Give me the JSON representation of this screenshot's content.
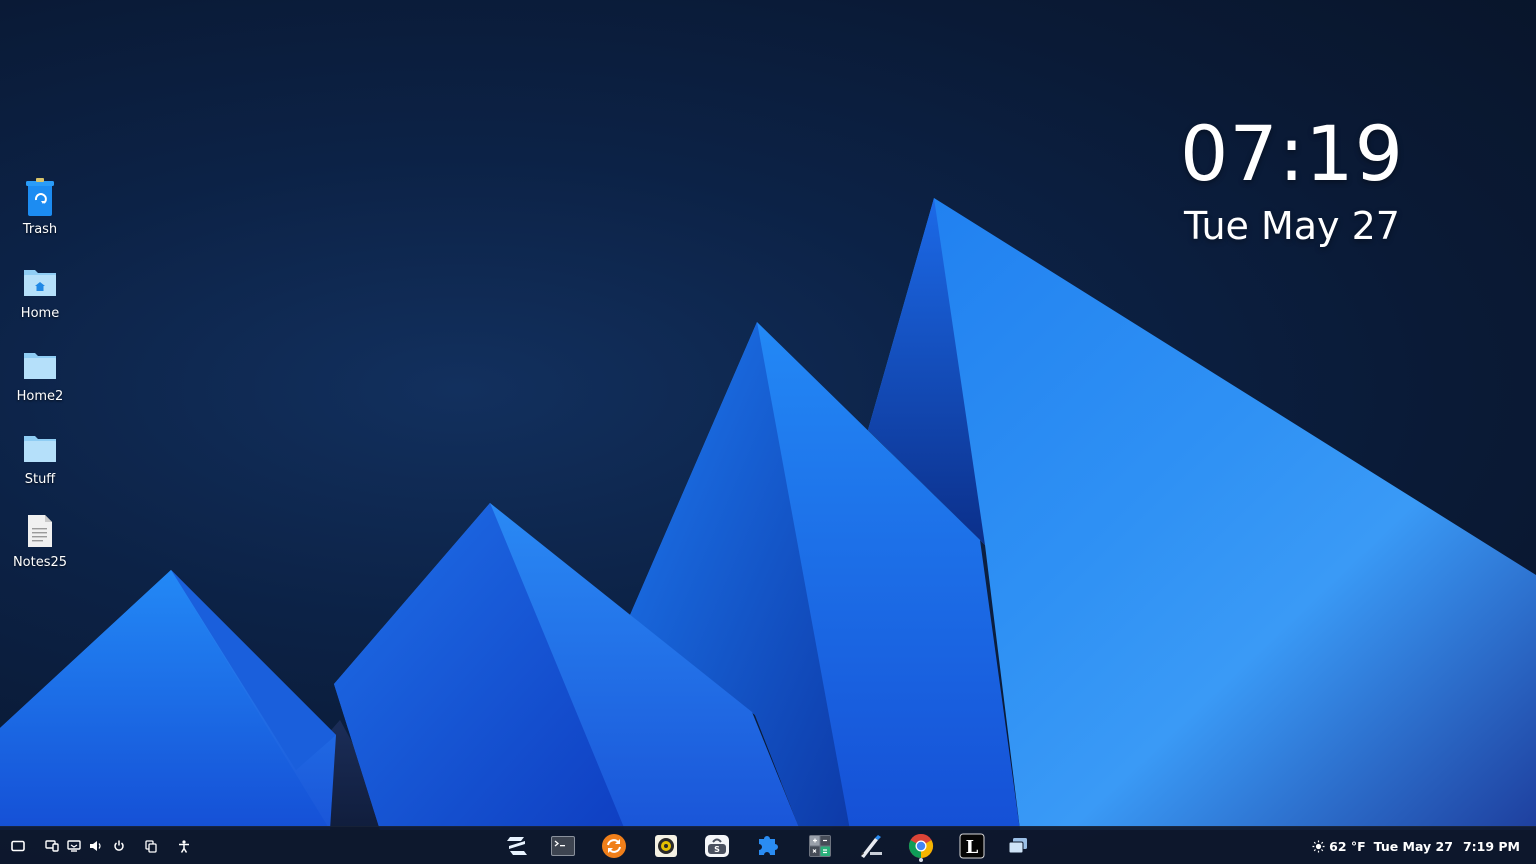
{
  "desktop_icons": [
    {
      "label": "Trash",
      "icon": "trash-icon"
    },
    {
      "label": "Home",
      "icon": "home-folder-icon"
    },
    {
      "label": "Home2",
      "icon": "folder-icon"
    },
    {
      "label": "Stuff",
      "icon": "folder-icon"
    },
    {
      "label": "Notes25",
      "icon": "text-file-icon"
    }
  ],
  "clock_widget": {
    "time": "07:19",
    "date": "Tue May 27"
  },
  "taskbar": {
    "tray_left_icons": [
      "show-desktop-icon",
      "network-icon",
      "display-icon",
      "volume-icon",
      "power-icon",
      "workspaces-icon",
      "accessibility-icon"
    ],
    "apps": [
      {
        "name": "zorin-menu",
        "icon": "zorin-logo-icon"
      },
      {
        "name": "terminal",
        "icon": "terminal-icon"
      },
      {
        "name": "software-updater",
        "icon": "software-updater-icon"
      },
      {
        "name": "rhythmbox",
        "icon": "rhythmbox-icon"
      },
      {
        "name": "software-store",
        "icon": "software-store-icon"
      },
      {
        "name": "extensions",
        "icon": "puzzle-piece-icon"
      },
      {
        "name": "calculator",
        "icon": "calculator-icon"
      },
      {
        "name": "text-editor",
        "icon": "pen-tool-icon"
      },
      {
        "name": "chrome",
        "icon": "chrome-icon"
      },
      {
        "name": "libreoffice",
        "icon": "libreoffice-icon"
      },
      {
        "name": "window-switcher",
        "icon": "windows-icon"
      }
    ],
    "status": {
      "weather": "62 °F",
      "date": "Tue May 27",
      "time": "7:19 PM"
    }
  },
  "colors": {
    "background": "#0a1a36",
    "mountain_primary": "#1e7ff0",
    "taskbar": "#0e182c",
    "text": "#ffffff"
  }
}
